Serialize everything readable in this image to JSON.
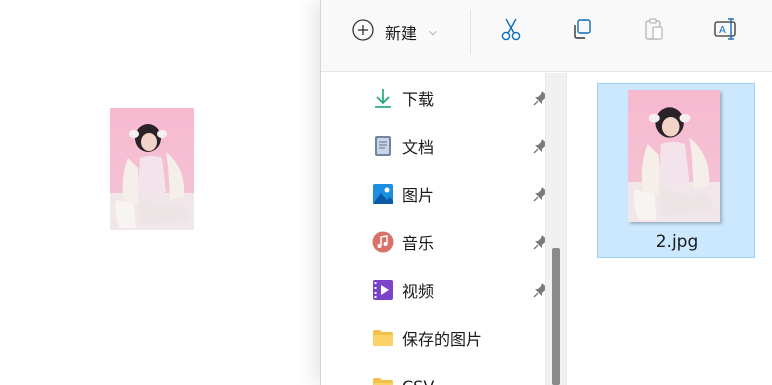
{
  "toolbar": {
    "new_label": "新建",
    "new_caret": "⌵",
    "cut_icon": "scissors-icon",
    "copy_icon": "copy-icon",
    "paste_icon": "paste-icon",
    "rename_icon": "rename-icon"
  },
  "nav": {
    "items": [
      {
        "label": "下载",
        "icon": "download-icon",
        "pinned": true
      },
      {
        "label": "文档",
        "icon": "documents-icon",
        "pinned": true
      },
      {
        "label": "图片",
        "icon": "pictures-icon",
        "pinned": true
      },
      {
        "label": "音乐",
        "icon": "music-icon",
        "pinned": true
      },
      {
        "label": "视频",
        "icon": "videos-icon",
        "pinned": true
      },
      {
        "label": "保存的图片",
        "icon": "folder-icon",
        "pinned": false
      },
      {
        "label": "CSV",
        "icon": "folder-icon",
        "pinned": false
      }
    ]
  },
  "content": {
    "files": [
      {
        "name": "2.jpg",
        "selected": true
      }
    ]
  },
  "colors": {
    "selection_bg": "#cce8ff",
    "selection_border": "#99d1ff",
    "accent": "#0067c0"
  }
}
